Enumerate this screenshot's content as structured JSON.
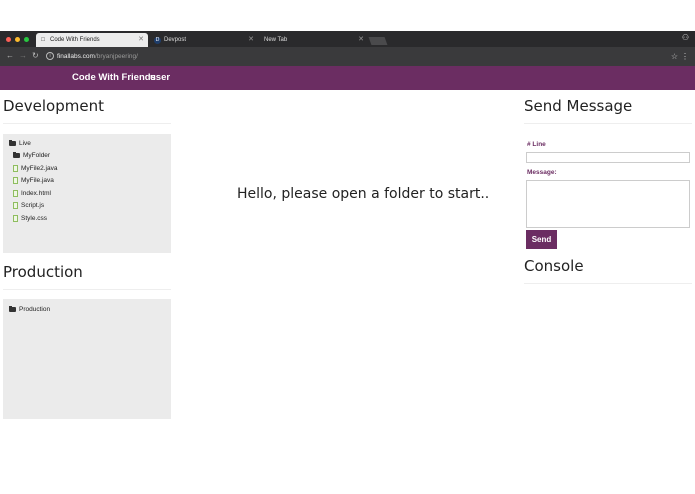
{
  "browser": {
    "tabs": [
      {
        "title": "Code With Friends",
        "active": true,
        "icon": "page-icon"
      },
      {
        "title": "Devpost",
        "active": false,
        "icon": "devpost-icon",
        "icon_letter": "D"
      },
      {
        "title": "New Tab",
        "active": false,
        "icon": "none"
      }
    ],
    "url_host": "finallabs.com",
    "url_path": "/bryanjpeering/",
    "traffic_colors": [
      "#fc5f57",
      "#fdbc2e",
      "#28c840"
    ]
  },
  "navbar": {
    "brand": "Code With Friends",
    "user_link": "user",
    "background": "#6b2d62"
  },
  "development": {
    "title": "Development",
    "tree": [
      {
        "label": "Live",
        "type": "folder",
        "depth": 0
      },
      {
        "label": "MyFolder",
        "type": "folder",
        "depth": 1
      },
      {
        "label": "MyFile2.java",
        "type": "file",
        "depth": 1
      },
      {
        "label": "MyFile.java",
        "type": "file",
        "depth": 1
      },
      {
        "label": "Index.html",
        "type": "file",
        "depth": 1
      },
      {
        "label": "Script.js",
        "type": "file",
        "depth": 1
      },
      {
        "label": "Style.css",
        "type": "file",
        "depth": 1
      }
    ]
  },
  "production": {
    "title": "Production",
    "tree": [
      {
        "label": "Production",
        "type": "folder",
        "depth": 0
      }
    ]
  },
  "main": {
    "message": "Hello, please open a folder to start.."
  },
  "send_message": {
    "title": "Send Message",
    "line_label": "# Line",
    "line_value": "",
    "message_label": "Message:",
    "message_value": "",
    "send_label": "Send"
  },
  "console": {
    "title": "Console"
  }
}
